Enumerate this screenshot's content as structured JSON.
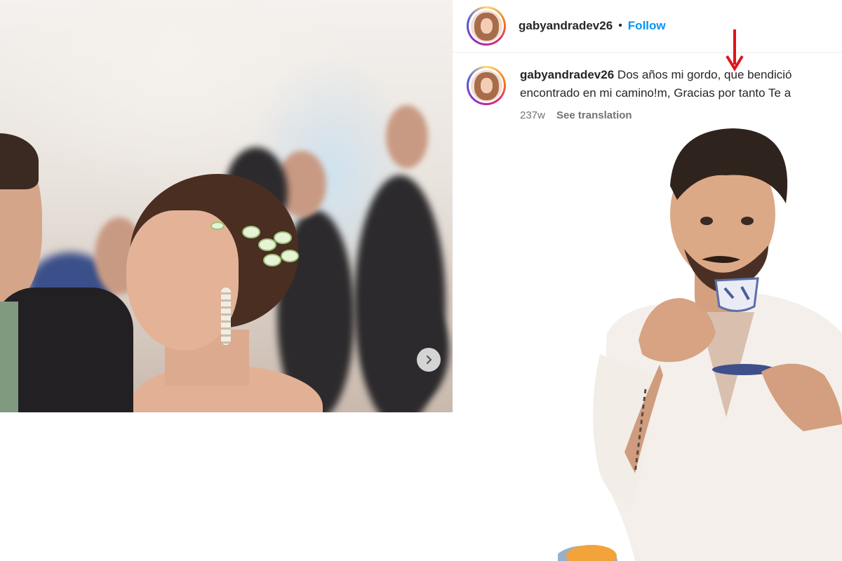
{
  "post": {
    "username": "gabyandradev26",
    "separator": "•",
    "follow_label": "Follow",
    "caption_line1": "Dos años mi gordo, que bendició",
    "caption_line2": "encontrado en mi camino!m, Gracias por tanto Te a",
    "timestamp": "237w",
    "see_translation_label": "See translation"
  },
  "photo": {
    "alt": ""
  },
  "colors": {
    "follow_blue": "#0095f6",
    "annotation_red": "#e1141c",
    "meta_grey": "#737373"
  },
  "icons": {
    "carousel": "chevron-right-icon",
    "annotation": "arrow-down-icon"
  }
}
